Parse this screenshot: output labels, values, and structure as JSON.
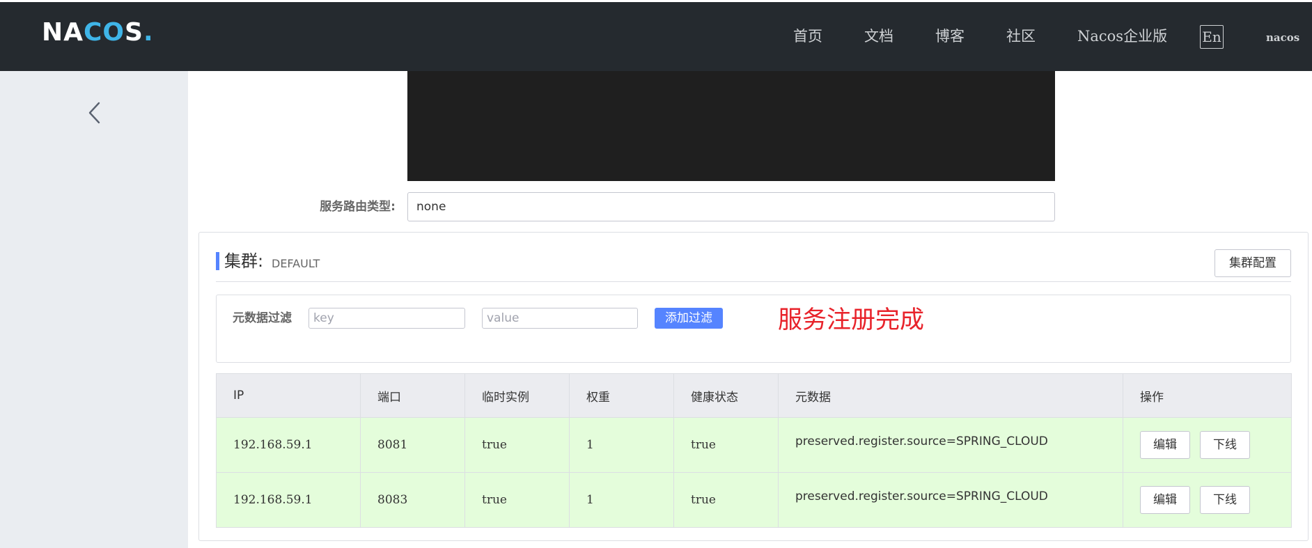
{
  "header": {
    "logo": {
      "part1": "NA",
      "part2": "CO",
      "part3": "S",
      "dot": "."
    },
    "nav": [
      {
        "label": "首页"
      },
      {
        "label": "文档"
      },
      {
        "label": "博客"
      },
      {
        "label": "社区"
      },
      {
        "label": "Nacos企业版"
      }
    ],
    "language_button": "En",
    "username": "nacos"
  },
  "sidebar": {
    "collapse_icon": "chevron-left-icon"
  },
  "service": {
    "route_type_label": "服务路由类型:",
    "route_type_value": "none"
  },
  "cluster": {
    "title": "集群:",
    "name": "DEFAULT",
    "config_button": "集群配置",
    "filter": {
      "label": "元数据过滤",
      "key_placeholder": "key",
      "value_placeholder": "value",
      "add_button": "添加过滤"
    },
    "annotation": "服务注册完成",
    "table": {
      "columns": [
        "IP",
        "端口",
        "临时实例",
        "权重",
        "健康状态",
        "元数据",
        "操作"
      ],
      "rows": [
        {
          "ip": "192.168.59.1",
          "port": "8081",
          "ephemeral": "true",
          "weight": "1",
          "healthy": "true",
          "metadata": "preserved.register.source=SPRING_CLOUD",
          "edit": "编辑",
          "offline": "下线"
        },
        {
          "ip": "192.168.59.1",
          "port": "8083",
          "ephemeral": "true",
          "weight": "1",
          "healthy": "true",
          "metadata": "preserved.register.source=SPRING_CLOUD",
          "edit": "编辑",
          "offline": "下线"
        }
      ]
    }
  },
  "colors": {
    "header_bg": "#252a2f",
    "sidebar_bg": "#eaedf1",
    "accent": "#5584ff",
    "row_bg": "#e4fddb",
    "annotation": "#e8232b"
  }
}
